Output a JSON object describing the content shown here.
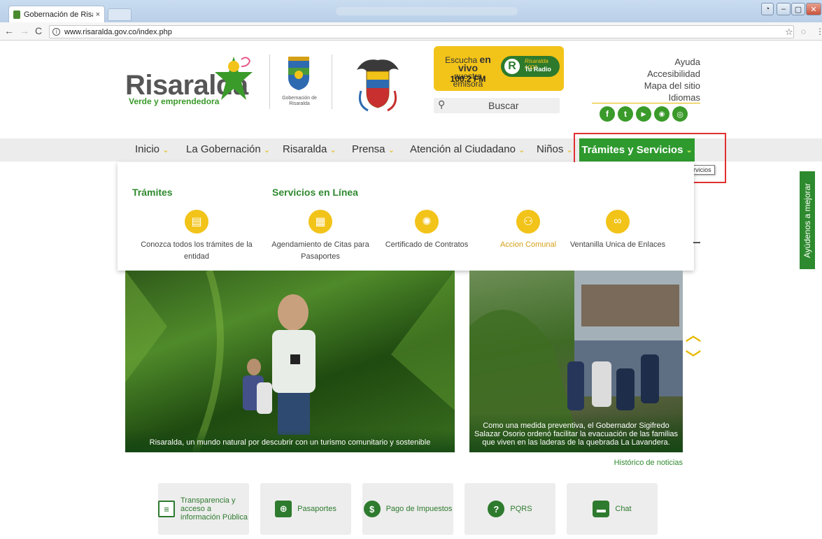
{
  "browser": {
    "tab_title": "Gobernación de Risaraldi",
    "url": "www.risaralda.gov.co/index.php",
    "tab_close": "×"
  },
  "header": {
    "logo_name": "Risaralda",
    "logo_slogan": "Verde y emprendedora",
    "gob_label": "Gobernación de Risaralda",
    "radio": {
      "line1": "Escucha ",
      "line1_bold": "en vivo",
      "line2": "nuestra emisora",
      "freq": "100.2 FM",
      "brand": "Risaralda 1002",
      "brand2": "Tu Radio"
    },
    "search_placeholder": "Buscar",
    "top_links": [
      "Ayuda",
      "Accesibilidad",
      "Mapa del sitio",
      "Idiomas"
    ],
    "social": [
      "f",
      "t",
      "▶",
      "◉",
      "◎"
    ]
  },
  "nav": {
    "items": [
      "Inicio",
      "La Gobernación",
      "Risaralda",
      "Prensa",
      "Atención al Ciudadano",
      "Niños"
    ],
    "active": "Trámites y Servicios",
    "tooltip": "Trámites y Servicios"
  },
  "mega_menu": {
    "heading_left": "Trámites",
    "heading_right": "Servicios en Línea",
    "services": [
      {
        "label": "Conozca todos los trámites de la entidad",
        "icon": "document-icon"
      },
      {
        "label": "Agendamiento de Citas para Pasaportes",
        "icon": "calendar-icon"
      },
      {
        "label": "Certificado de Contratos",
        "icon": "seal-icon"
      },
      {
        "label": "Accion Comunal",
        "icon": "people-icon"
      },
      {
        "label": "Ventanilla Unica de Enlaces",
        "icon": "link-icon"
      }
    ]
  },
  "news": {
    "caption1": "Risaralda, un mundo natural por descubrir con un turismo comunitario y sostenible",
    "caption2": "Como una medida preventiva, el Gobernador Sigifredo Salazar Osorio ordenó facilitar la evacuación de las familias que viven en las laderas de la quebrada La Lavandera.",
    "history_link": "Histórico de noticias"
  },
  "tiles": [
    {
      "label": "Transparencia y acceso a información Pública",
      "icon": "document-icon"
    },
    {
      "label": "Pasaportes",
      "icon": "passport-icon"
    },
    {
      "label": "Pago de Impuestos",
      "icon": "dollar-icon"
    },
    {
      "label": "PQRS",
      "icon": "question-icon"
    },
    {
      "label": "Chat",
      "icon": "chat-icon"
    }
  ],
  "feedback_tab": "Ayúdenos a mejorar",
  "colors": {
    "brand_green": "#2e9a2e",
    "brand_yellow": "#f2c319",
    "highlight_red": "#e03030"
  }
}
